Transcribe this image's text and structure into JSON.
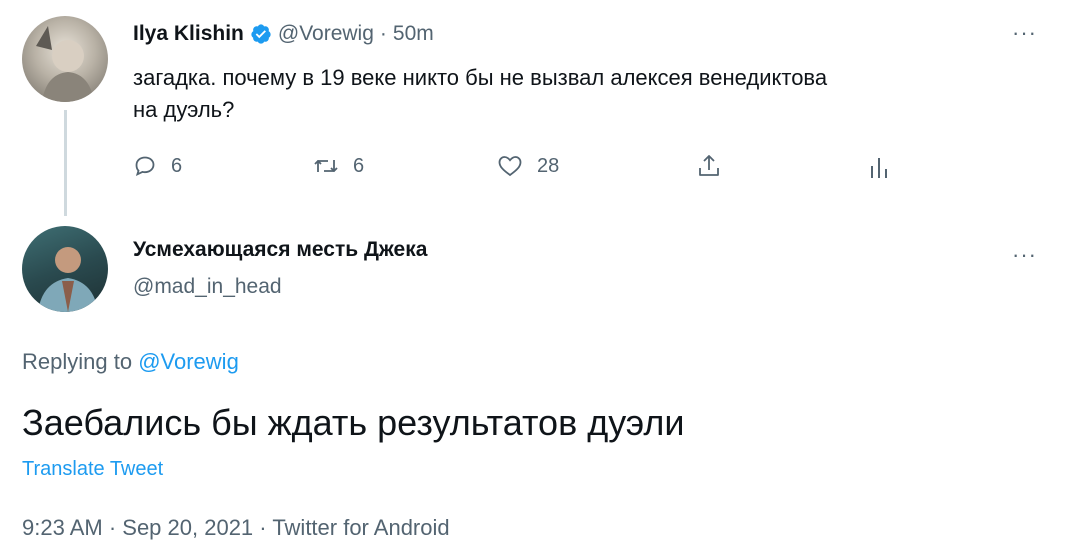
{
  "original_tweet": {
    "author_name": "Ilya Klishin",
    "handle": "@Vorewig",
    "separator": "·",
    "time": "50m",
    "text_line1": "загадка. почему в 19 веке никто бы не вызвал алексея венедиктова",
    "text_line2": "на дуэль?",
    "more": "···",
    "actions": {
      "reply_count": "6",
      "retweet_count": "6",
      "like_count": "28"
    }
  },
  "reply_tweet": {
    "author_name": "Усмехающаяся месть Джека",
    "handle": "@mad_in_head",
    "more": "···",
    "replying_prefix": "Replying to",
    "replying_handle": "@Vorewig",
    "text": "Заебались бы ждать результатов дуэли",
    "translate_label": "Translate Tweet",
    "meta": "9:23 AM · Sep 20, 2021 · Twitter for Android"
  },
  "colors": {
    "accent": "#1d9bf0",
    "secondary_text": "#536471",
    "primary_text": "#0f1419"
  }
}
